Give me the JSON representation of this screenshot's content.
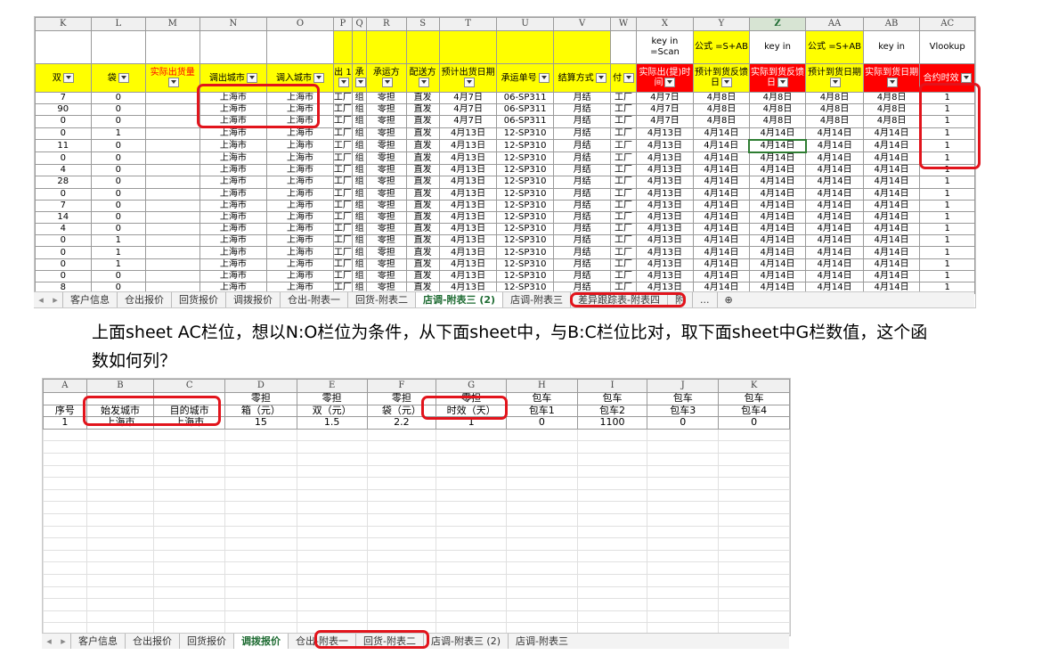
{
  "sheet1": {
    "columns": [
      "K",
      "L",
      "M",
      "N",
      "O",
      "P",
      "Q",
      "R",
      "S",
      "T",
      "U",
      "V",
      "W",
      "X",
      "Y",
      "Z",
      "AA",
      "AB",
      "AC"
    ],
    "selected_column": "Z",
    "notes_row": [
      "",
      "",
      "",
      "",
      "",
      "",
      "",
      "",
      "",
      "",
      "",
      "",
      "",
      "key in =Scan",
      "公式 =S+AB",
      "key in",
      "公式 =S+AB",
      "key in",
      "Vlookup"
    ],
    "header_row": [
      "双",
      "袋",
      "实际出货量",
      "调出城市",
      "调入城市",
      "出 1",
      "承",
      "承运方",
      "配送方",
      "预计出货日期",
      "承运单号",
      "结算方式",
      "付",
      "实际出(提)时间",
      "预计到货反馈日",
      "实际到货反馈日",
      "预计到货日期",
      "实际到货日期",
      "合约时效"
    ],
    "rows": [
      [
        "7",
        "0",
        "",
        "上海市",
        "上海市",
        "工厂",
        "组",
        "零担",
        "直发",
        "4月7日",
        "06-SP311",
        "月结",
        "工厂",
        "4月7日",
        "4月8日",
        "4月8日",
        "4月8日",
        "4月8日",
        "1"
      ],
      [
        "90",
        "0",
        "",
        "上海市",
        "上海市",
        "工厂",
        "组",
        "零担",
        "直发",
        "4月7日",
        "06-SP311",
        "月结",
        "工厂",
        "4月7日",
        "4月8日",
        "4月8日",
        "4月8日",
        "4月8日",
        "1"
      ],
      [
        "0",
        "0",
        "",
        "上海市",
        "上海市",
        "工厂",
        "组",
        "零担",
        "直发",
        "4月7日",
        "06-SP311",
        "月结",
        "工厂",
        "4月7日",
        "4月8日",
        "4月8日",
        "4月8日",
        "4月8日",
        "1"
      ],
      [
        "0",
        "1",
        "",
        "上海市",
        "上海市",
        "工厂",
        "组",
        "零担",
        "直发",
        "4月13日",
        "12-SP310",
        "月结",
        "工厂",
        "4月13日",
        "4月14日",
        "4月14日",
        "4月14日",
        "4月14日",
        "1"
      ],
      [
        "11",
        "0",
        "",
        "上海市",
        "上海市",
        "工厂",
        "组",
        "零担",
        "直发",
        "4月13日",
        "12-SP310",
        "月结",
        "工厂",
        "4月13日",
        "4月14日",
        "4月14日",
        "4月14日",
        "4月14日",
        "1"
      ],
      [
        "0",
        "0",
        "",
        "上海市",
        "上海市",
        "工厂",
        "组",
        "零担",
        "直发",
        "4月13日",
        "12-SP310",
        "月结",
        "工厂",
        "4月13日",
        "4月14日",
        "4月14日",
        "4月14日",
        "4月14日",
        "1"
      ],
      [
        "4",
        "0",
        "",
        "上海市",
        "上海市",
        "工厂",
        "组",
        "零担",
        "直发",
        "4月13日",
        "12-SP310",
        "月结",
        "工厂",
        "4月13日",
        "4月14日",
        "4月14日",
        "4月14日",
        "4月14日",
        "1"
      ],
      [
        "28",
        "0",
        "",
        "上海市",
        "上海市",
        "工厂",
        "组",
        "零担",
        "直发",
        "4月13日",
        "12-SP310",
        "月结",
        "工厂",
        "4月13日",
        "4月14日",
        "4月14日",
        "4月14日",
        "4月14日",
        "1"
      ],
      [
        "0",
        "0",
        "",
        "上海市",
        "上海市",
        "工厂",
        "组",
        "零担",
        "直发",
        "4月13日",
        "12-SP310",
        "月结",
        "工厂",
        "4月13日",
        "4月14日",
        "4月14日",
        "4月14日",
        "4月14日",
        "1"
      ],
      [
        "7",
        "0",
        "",
        "上海市",
        "上海市",
        "工厂",
        "组",
        "零担",
        "直发",
        "4月13日",
        "12-SP310",
        "月结",
        "工厂",
        "4月13日",
        "4月14日",
        "4月14日",
        "4月14日",
        "4月14日",
        "1"
      ],
      [
        "14",
        "0",
        "",
        "上海市",
        "上海市",
        "工厂",
        "组",
        "零担",
        "直发",
        "4月13日",
        "12-SP310",
        "月结",
        "工厂",
        "4月13日",
        "4月14日",
        "4月14日",
        "4月14日",
        "4月14日",
        "1"
      ],
      [
        "4",
        "0",
        "",
        "上海市",
        "上海市",
        "工厂",
        "组",
        "零担",
        "直发",
        "4月13日",
        "12-SP310",
        "月结",
        "工厂",
        "4月13日",
        "4月14日",
        "4月14日",
        "4月14日",
        "4月14日",
        "1"
      ],
      [
        "0",
        "1",
        "",
        "上海市",
        "上海市",
        "工厂",
        "组",
        "零担",
        "直发",
        "4月13日",
        "12-SP310",
        "月结",
        "工厂",
        "4月13日",
        "4月14日",
        "4月14日",
        "4月14日",
        "4月14日",
        "1"
      ],
      [
        "0",
        "1",
        "",
        "上海市",
        "上海市",
        "工厂",
        "组",
        "零担",
        "直发",
        "4月13日",
        "12-SP310",
        "月结",
        "工厂",
        "4月13日",
        "4月14日",
        "4月14日",
        "4月14日",
        "4月14日",
        "1"
      ],
      [
        "0",
        "1",
        "",
        "上海市",
        "上海市",
        "工厂",
        "组",
        "零担",
        "直发",
        "4月13日",
        "12-SP310",
        "月结",
        "工厂",
        "4月13日",
        "4月14日",
        "4月14日",
        "4月14日",
        "4月14日",
        "1"
      ],
      [
        "0",
        "0",
        "",
        "上海市",
        "上海市",
        "工厂",
        "组",
        "零担",
        "直发",
        "4月13日",
        "12-SP310",
        "月结",
        "工厂",
        "4月13日",
        "4月14日",
        "4月14日",
        "4月14日",
        "4月14日",
        "1"
      ],
      [
        "8",
        "0",
        "",
        "上海市",
        "上海市",
        "工厂",
        "组",
        "零担",
        "直发",
        "4月13日",
        "12-SP310",
        "月结",
        "工厂",
        "4月13日",
        "4月14日",
        "4月14日",
        "4月14日",
        "4月14日",
        "1"
      ]
    ],
    "tabs": [
      "客户信息",
      "仓出报价",
      "回货报价",
      "调拨报价",
      "仓出-附表一",
      "回货-附表二",
      "店调-附表三 (2)",
      "店调-附表三",
      "差异跟踪表-附表四",
      "附"
    ],
    "active_tab": "店调-附表三 (2)",
    "more_label": "...",
    "add_sheet_label": "⊕"
  },
  "question": "上面sheet AC栏位，想以N:O栏位为条件，从下面sheet中，与B:C栏位比对，取下面sheet中G栏数值，这个函数如何列？",
  "sheet2": {
    "columns": [
      "A",
      "B",
      "C",
      "D",
      "E",
      "F",
      "G",
      "H",
      "I",
      "J",
      "K"
    ],
    "group_row": [
      "",
      "",
      "",
      "零担",
      "零担",
      "零担",
      "零担",
      "包车",
      "包车",
      "包车",
      "包车"
    ],
    "header_row": [
      "序号",
      "始发城市",
      "目的城市",
      "箱（元）",
      "双（元）",
      "袋（元）",
      "时效（天）",
      "包车1",
      "包车2",
      "包车3",
      "包车4"
    ],
    "data_row": [
      "1",
      "上海市",
      "上海市",
      "15",
      "1.5",
      "2.2",
      "1",
      "0",
      "1100",
      "0",
      "0"
    ],
    "tabs": [
      "客户信息",
      "仓出报价",
      "回货报价",
      "调拨报价",
      "仓出-附表一",
      "回货-附表二",
      "店调-附表三 (2)",
      "店调-附表三"
    ],
    "active_tab": "调拨报价"
  },
  "colors": {
    "highlight_red": "#e2141c",
    "header_yellow": "#ffff00",
    "header_red": "#ff0000",
    "selected_green": "#1e6b32"
  }
}
